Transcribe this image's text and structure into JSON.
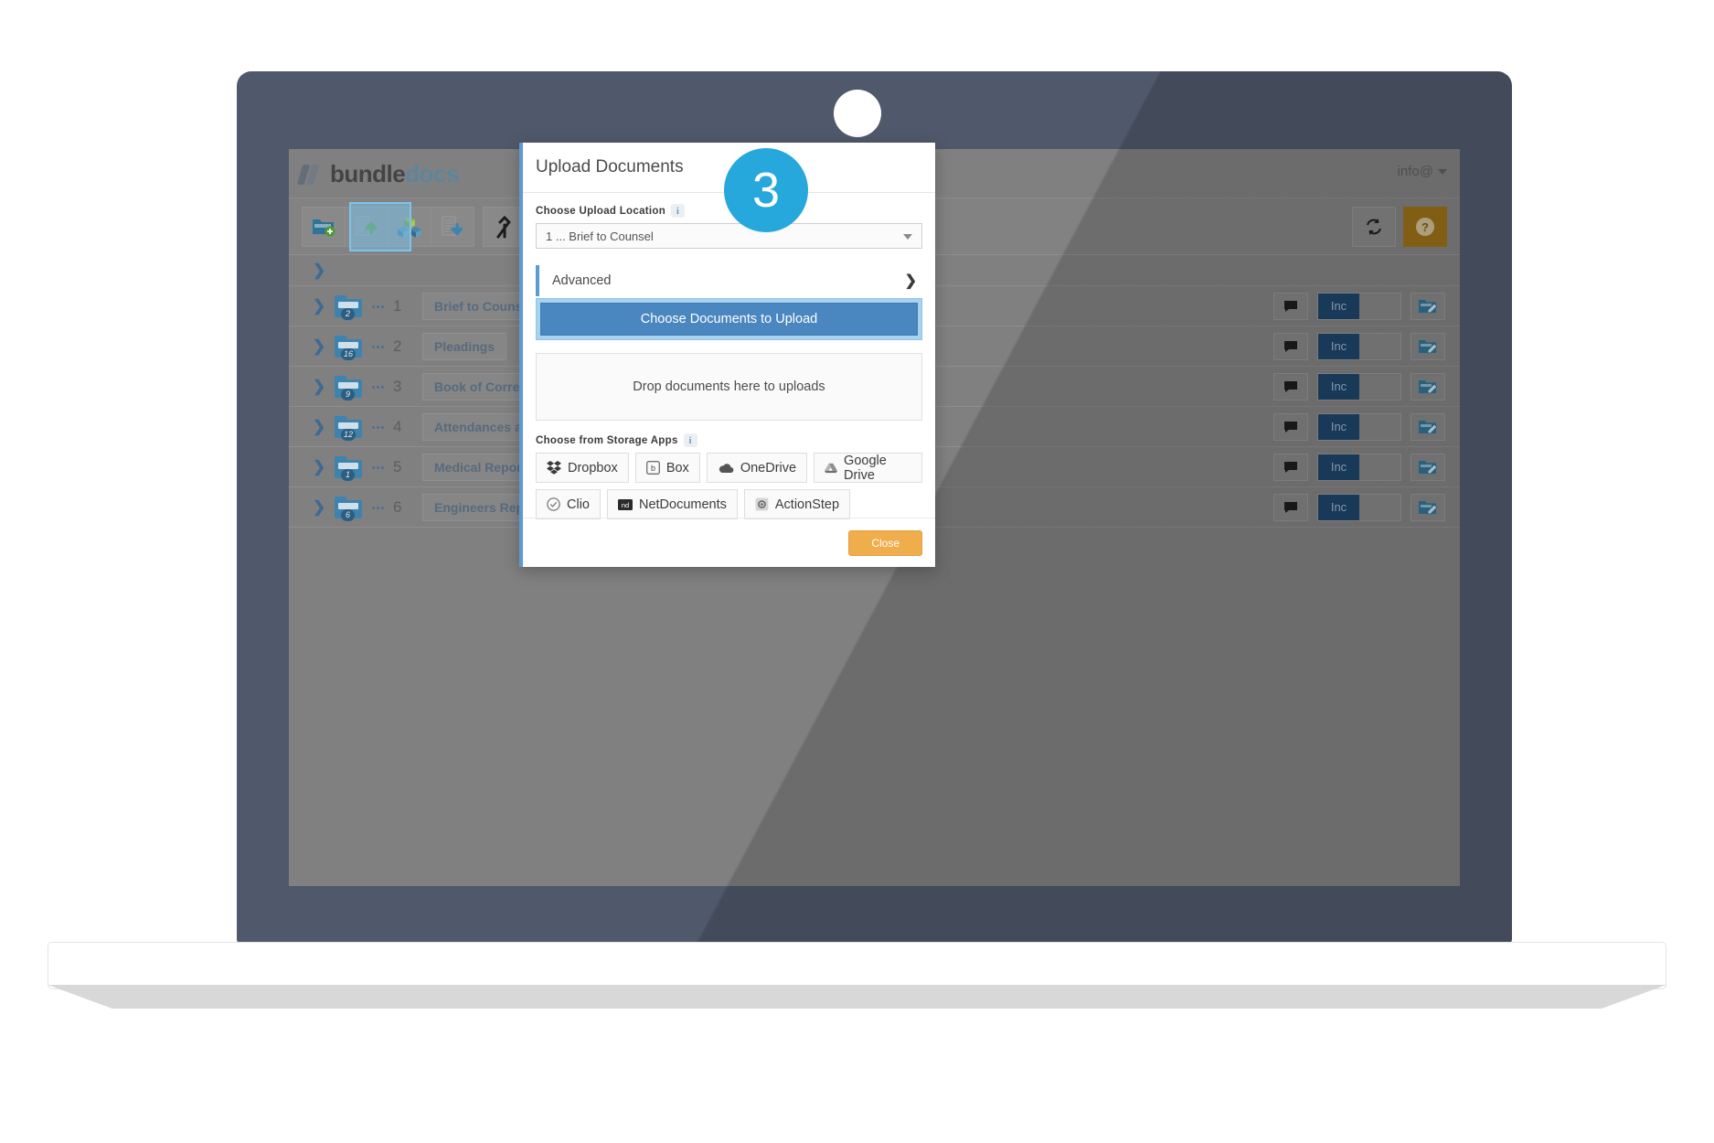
{
  "app": {
    "brand": {
      "part1": "bundle",
      "part2": "docs"
    },
    "account": "info@"
  },
  "toolbar": {
    "buttons": [
      {
        "name": "new-folder",
        "icon": "folder-add-icon"
      },
      {
        "name": "upload-document",
        "icon": "document-upload-icon"
      },
      {
        "name": "combine-sections",
        "icon": "cubes-icon"
      },
      {
        "name": "download-document",
        "icon": "document-download-icon"
      },
      {
        "name": "merge-bundle",
        "icon": "merge-arrows-icon"
      },
      {
        "name": "merge-dropdown",
        "icon": "chevron-down-icon"
      },
      {
        "name": "save-bundle",
        "icon": "save-disk-icon"
      }
    ],
    "refresh_label": "",
    "help_label": "?"
  },
  "folders": {
    "rows": [
      {
        "num": "1",
        "name": "Brief to Counsel",
        "badge": "2",
        "inc": "Inc"
      },
      {
        "num": "2",
        "name": "Pleadings",
        "badge": "16",
        "inc": "Inc"
      },
      {
        "num": "3",
        "name": "Book of Correspondence",
        "badge": "9",
        "inc": "Inc"
      },
      {
        "num": "4",
        "name": "Attendances and Statements",
        "badge": "12",
        "inc": "Inc"
      },
      {
        "num": "5",
        "name": "Medical Reports",
        "badge": "1",
        "inc": "Inc"
      },
      {
        "num": "6",
        "name": "Engineers Reports",
        "badge": "6",
        "inc": "Inc"
      }
    ]
  },
  "modal": {
    "title": "Upload Documents",
    "upload_location_label": "Choose Upload Location",
    "upload_location_value": "1 ... Brief to Counsel",
    "advanced_label": "Advanced",
    "choose_documents_label": "Choose Documents to Upload",
    "dropzone_label": "Drop documents here to uploads",
    "storage_apps_label": "Choose from Storage Apps",
    "storage_apps_row1": [
      {
        "label": "Dropbox",
        "icon": "dropbox-icon"
      },
      {
        "label": "Box",
        "icon": "box-icon"
      },
      {
        "label": "OneDrive",
        "icon": "onedrive-icon"
      },
      {
        "label": "Google Drive",
        "icon": "google-drive-icon"
      }
    ],
    "storage_apps_row2": [
      {
        "label": "Clio",
        "icon": "clio-icon"
      },
      {
        "label": "NetDocuments",
        "icon": "netdocuments-icon"
      },
      {
        "label": "ActionStep",
        "icon": "actionstep-icon"
      }
    ],
    "close_label": "Close",
    "info_glyph": "i"
  },
  "step": {
    "number": "3"
  },
  "colors": {
    "accent_blue": "#5b9bd5",
    "step_badge": "#26a8dd",
    "primary_button": "#4a86c0",
    "close_button": "#efad4b",
    "help_button": "#9a7018",
    "laptop_body": "#50596b"
  }
}
